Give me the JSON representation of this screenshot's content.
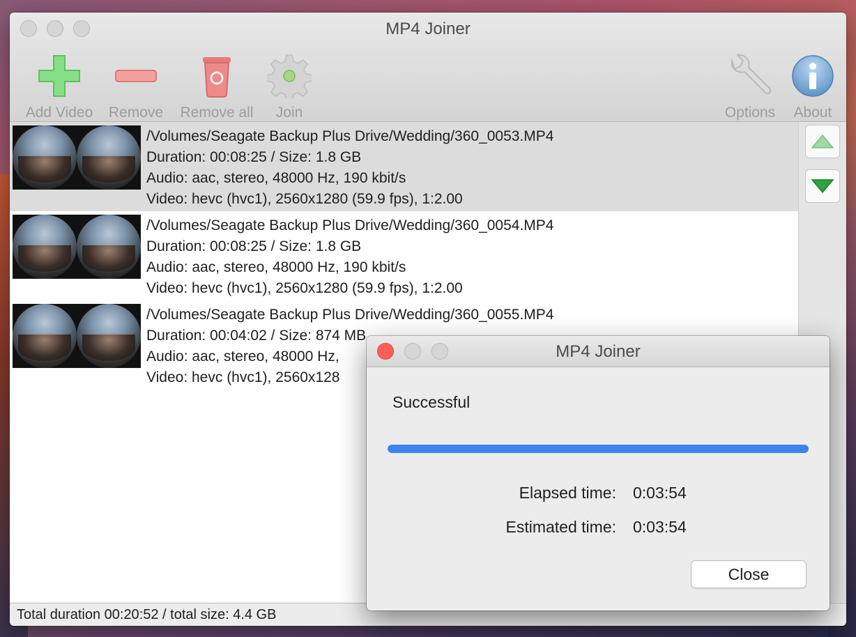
{
  "window": {
    "title": "MP4 Joiner"
  },
  "toolbar": {
    "add_video": "Add Video",
    "remove": "Remove",
    "remove_all": "Remove all",
    "join": "Join",
    "options": "Options",
    "about": "About"
  },
  "files": [
    {
      "path": "/Volumes/Seagate Backup Plus Drive/Wedding/360_0053.MP4",
      "duration": "Duration: 00:08:25 / Size: 1.8 GB",
      "audio": "Audio: aac, stereo, 48000 Hz, 190 kbit/s",
      "video": "Video: hevc (hvc1), 2560x1280 (59.9 fps), 1:2.00",
      "selected": true
    },
    {
      "path": "/Volumes/Seagate Backup Plus Drive/Wedding/360_0054.MP4",
      "duration": "Duration: 00:08:25 / Size: 1.8 GB",
      "audio": "Audio: aac, stereo, 48000 Hz, 190 kbit/s",
      "video": "Video: hevc (hvc1), 2560x1280 (59.9 fps), 1:2.00",
      "selected": false
    },
    {
      "path": "/Volumes/Seagate Backup Plus Drive/Wedding/360_0055.MP4",
      "duration": "Duration: 00:04:02 / Size: 874 MB",
      "audio": "Audio: aac, stereo, 48000 Hz,",
      "video": "Video: hevc (hvc1), 2560x128",
      "selected": false
    }
  ],
  "status_bar": {
    "text": "Total duration 00:20:52 / total size: 4.4 GB"
  },
  "dialog": {
    "title": "MP4 Joiner",
    "status": "Successful",
    "progress_percent": 100,
    "elapsed_label": "Elapsed time:",
    "elapsed_value": "0:03:54",
    "estimated_label": "Estimated time:",
    "estimated_value": "0:03:54",
    "close_label": "Close"
  },
  "colors": {
    "progress": "#3d83f0",
    "close_traffic": "#fc5f57",
    "add_icon": "#7ed67e",
    "remove_icon": "#f08c8c",
    "arrow": "#2fa33c"
  }
}
